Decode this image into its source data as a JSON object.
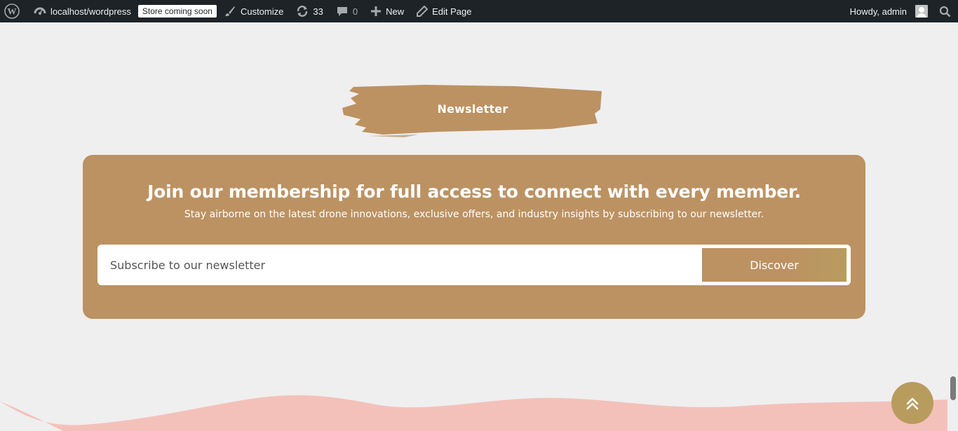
{
  "adminbar": {
    "site_name": "localhost/wordpress",
    "store_badge": "Store coming soon",
    "customize": "Customize",
    "updates_count": "33",
    "comments_count": "0",
    "new_label": "New",
    "edit_page": "Edit Page",
    "howdy": "Howdy, admin",
    "icons": [
      "wordpress-logo-icon",
      "dashboard-icon",
      "brush-icon",
      "updates-icon",
      "comment-icon",
      "plus-icon",
      "pencil-icon",
      "search-icon"
    ]
  },
  "section": {
    "label": "Newsletter"
  },
  "membership": {
    "title": "Join our membership for full access to connect with every member.",
    "subtitle": "Stay airborne on the latest drone innovations, exclusive offers, and industry insights by subscribing to our newsletter.",
    "input_placeholder": "Subscribe to our newsletter",
    "button_label": "Discover"
  },
  "colors": {
    "adminbar_bg": "#1d2327",
    "page_bg": "#efefef",
    "brand_tan": "#bc9262",
    "gold": "#b89c5e",
    "wave_pink": "#f4c1ba"
  },
  "back_to_top_icon": "double-chevron-up-icon"
}
